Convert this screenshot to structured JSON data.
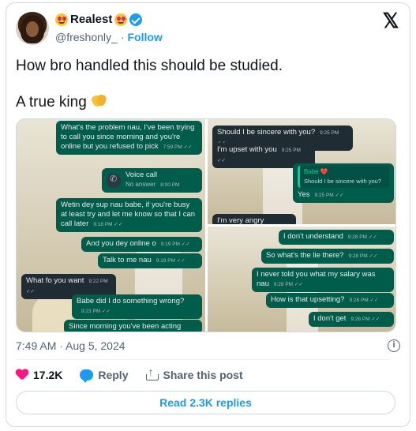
{
  "author": {
    "name": "Realest",
    "handle": "@freshonly_",
    "separator": "·",
    "follow_label": "Follow"
  },
  "platform_logo": "𝕏",
  "tweet": {
    "line1": "How bro handled this should be studied.",
    "line2": "A true king"
  },
  "chat_left": [
    {
      "dir": "out",
      "text": "What's the problem nau, I've been trying to call you since morning and you're online but you refused to pick",
      "time": "7:59 PM"
    },
    {
      "dir": "out",
      "kind": "voicecall",
      "text": "Voice call",
      "sub": "No answer",
      "time": "8:00 PM"
    },
    {
      "dir": "out",
      "text": "Wetin dey sup nau babe, if you're busy at least try and let me know so that I can call later",
      "time": "9:18 PM"
    },
    {
      "dir": "out",
      "text": "And you dey online o",
      "time": "9:19 PM"
    },
    {
      "dir": "out",
      "text": "Talk to me nau",
      "time": "9:19 PM"
    },
    {
      "dir": "in",
      "text": "What fo you want",
      "time": "9:22 PM"
    },
    {
      "dir": "out",
      "text": "Babe did I do something wrong?",
      "time": "9:23 PM"
    },
    {
      "dir": "out",
      "text": "Since morning you've been acting",
      "time": ""
    }
  ],
  "chat_right_top": [
    {
      "dir": "in",
      "text": "Should I be sincere with you?",
      "time": "9:25 PM"
    },
    {
      "dir": "in",
      "text": "I'm upset with you",
      "time": "9:25 PM"
    },
    {
      "dir": "out",
      "quote_name": "Babe ❤️",
      "quote_text": "Should I be sincere with you?",
      "text": "Yes",
      "time": "9:25 PM"
    },
    {
      "dir": "in",
      "text": "I'm very angry",
      "time": ""
    }
  ],
  "chat_right_bottom": [
    {
      "dir": "out",
      "text": "I don't understand",
      "time": "9:28 PM"
    },
    {
      "dir": "out",
      "text": "So what's the lie there?",
      "time": "9:28 PM"
    },
    {
      "dir": "out",
      "text": "I never told you what my salary was nau",
      "time": "9:28 PM"
    },
    {
      "dir": "out",
      "text": "How is that upsetting?",
      "time": "9:28 PM"
    },
    {
      "dir": "out",
      "text": "I don't get",
      "time": "9:28 PM"
    }
  ],
  "timestamp": "7:49 AM · Aug 5, 2024",
  "actions": {
    "likes": "17.2K",
    "reply_label": "Reply",
    "share_label": "Share this post"
  },
  "read_replies_label": "Read 2.3K replies",
  "icons": [
    "avatar",
    "heart-eyes-emoji",
    "verified-badge-icon",
    "x-logo-icon",
    "clap-emoji",
    "info-icon",
    "heart-icon",
    "reply-icon",
    "share-icon"
  ],
  "colors": {
    "accent": "#1d9bf0",
    "like": "#f91880",
    "wa_out": "#005c4b",
    "wa_in": "#202c33"
  }
}
